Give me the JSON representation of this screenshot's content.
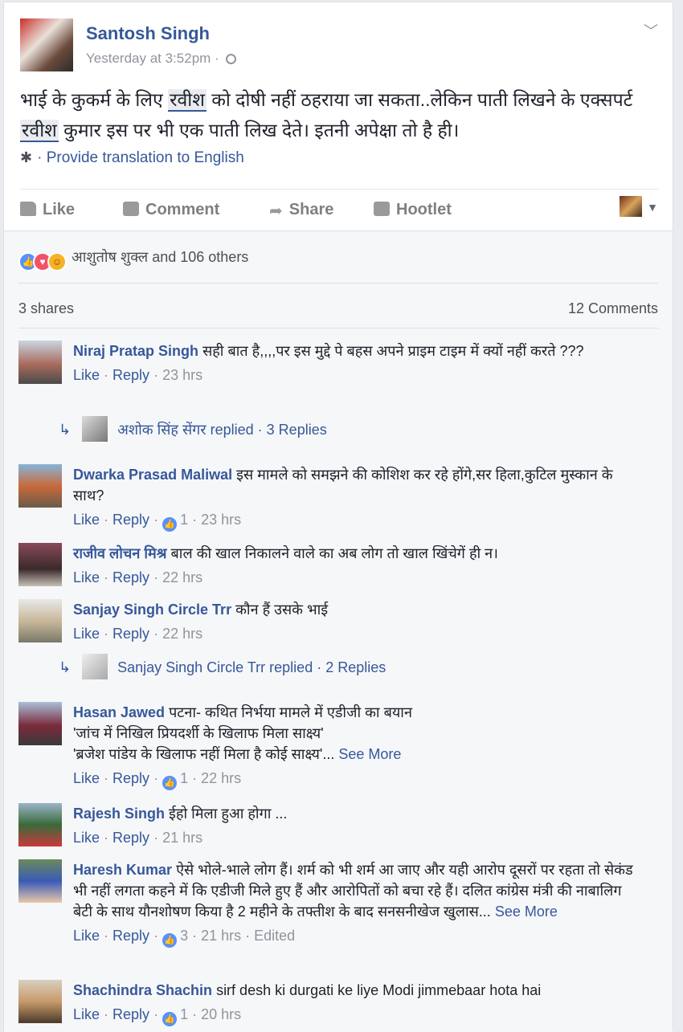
{
  "post": {
    "author": "Santosh Singh",
    "timestamp": "Yesterday at 3:52pm",
    "text_part1": "भाई के कुकर्म के लिए ",
    "highlight1": "रवीश",
    "text_part2": " को दोषी नहीं ठहराया जा सकता..लेकिन पाती लिखने के एक्सपर्ट ",
    "highlight2": "रवीश",
    "text_part3": " कुमार इस पर भी एक पाती लिख देते। इतनी अपेक्षा तो है ही।",
    "translate_label": "Provide translation to English",
    "icons": {
      "globe": "globe-icon",
      "chevron": "chevron-down-icon",
      "gear": "gear-icon"
    }
  },
  "actions": {
    "like": "Like",
    "comment": "Comment",
    "share": "Share",
    "hootlet": "Hootlet"
  },
  "feedback": {
    "reactions_text": "आशुतोष शुक्ल and 106 others",
    "shares": "3 shares",
    "comments_count": "12 Comments"
  },
  "comments": [
    {
      "name": "Niraj Pratap Singh",
      "text": "सही बात है,,,,पर इस मुद्दे पे बहस अपने प्राइम टाइम में क्यों नहीं करते ???",
      "like": "Like",
      "reply": "Reply",
      "likes": "",
      "time": "23 hrs",
      "replies": {
        "name": "अशोक सिंह सेंगर replied",
        "count": "3 Replies"
      }
    },
    {
      "name": "Dwarka Prasad Maliwal",
      "text": "इस मामले को समझने की कोशिश कर रहे होंगे,सर हिला,कुटिल मुस्कान के साथ?",
      "like": "Like",
      "reply": "Reply",
      "likes": "1",
      "time": "23 hrs"
    },
    {
      "name": "राजीव लोचन मिश्र",
      "text": "बाल की खाल निकालने वाले का अब लोग तो खाल खिंचेगें ही न।",
      "like": "Like",
      "reply": "Reply",
      "likes": "",
      "time": "22 hrs"
    },
    {
      "name": "Sanjay Singh Circle Trr",
      "text": "कौन हैं उसके भाई",
      "like": "Like",
      "reply": "Reply",
      "likes": "",
      "time": "22 hrs",
      "replies": {
        "name": "Sanjay Singh Circle Trr replied",
        "count": "2 Replies"
      }
    },
    {
      "name": "Hasan Jawed",
      "text": "पटना- कथित निर्भया मामले में एडीजी का बयान",
      "text_line2": "'जांच में निखिल प्रियदर्शी के खिलाफ मिला साक्ष्य'",
      "text_line3": "'ब्रजेश पांडेय के खिलाफ नहीं मिला है कोई साक्ष्य'...",
      "see_more": "See More",
      "like": "Like",
      "reply": "Reply",
      "likes": "1",
      "time": "22 hrs"
    },
    {
      "name": "Rajesh Singh",
      "text": "ईहो मिला हुआ होगा ...",
      "like": "Like",
      "reply": "Reply",
      "likes": "",
      "time": "21 hrs"
    },
    {
      "name": "Haresh Kumar",
      "text": "ऐसे भोले-भाले लोग हैं। शर्म को भी शर्म आ जाए और यही आरोप दूसरों पर रहता तो सेकंड भी नहीं लगता कहने में कि एडीजी मिले हुए हैं और आरोपितों को बचा रहे हैं। दलित कांग्रेस मंत्री की नाबालिग बेटी के साथ यौनशोषण किया है 2 महीने के तफ्तीश के बाद सनसनीखेज खुलास...",
      "see_more": "See More",
      "like": "Like",
      "reply": "Reply",
      "likes": "3",
      "time": "21 hrs",
      "edited": "Edited"
    },
    {
      "name": "Shachindra Shachin",
      "text": "sirf desh ki durgati ke liye Modi jimmebaar hota hai",
      "like": "Like",
      "reply": "Reply",
      "likes": "1",
      "time": "20 hrs"
    }
  ],
  "colors": {
    "link": "#365899",
    "meta": "#90949c",
    "like_blue": "#5890ff"
  }
}
